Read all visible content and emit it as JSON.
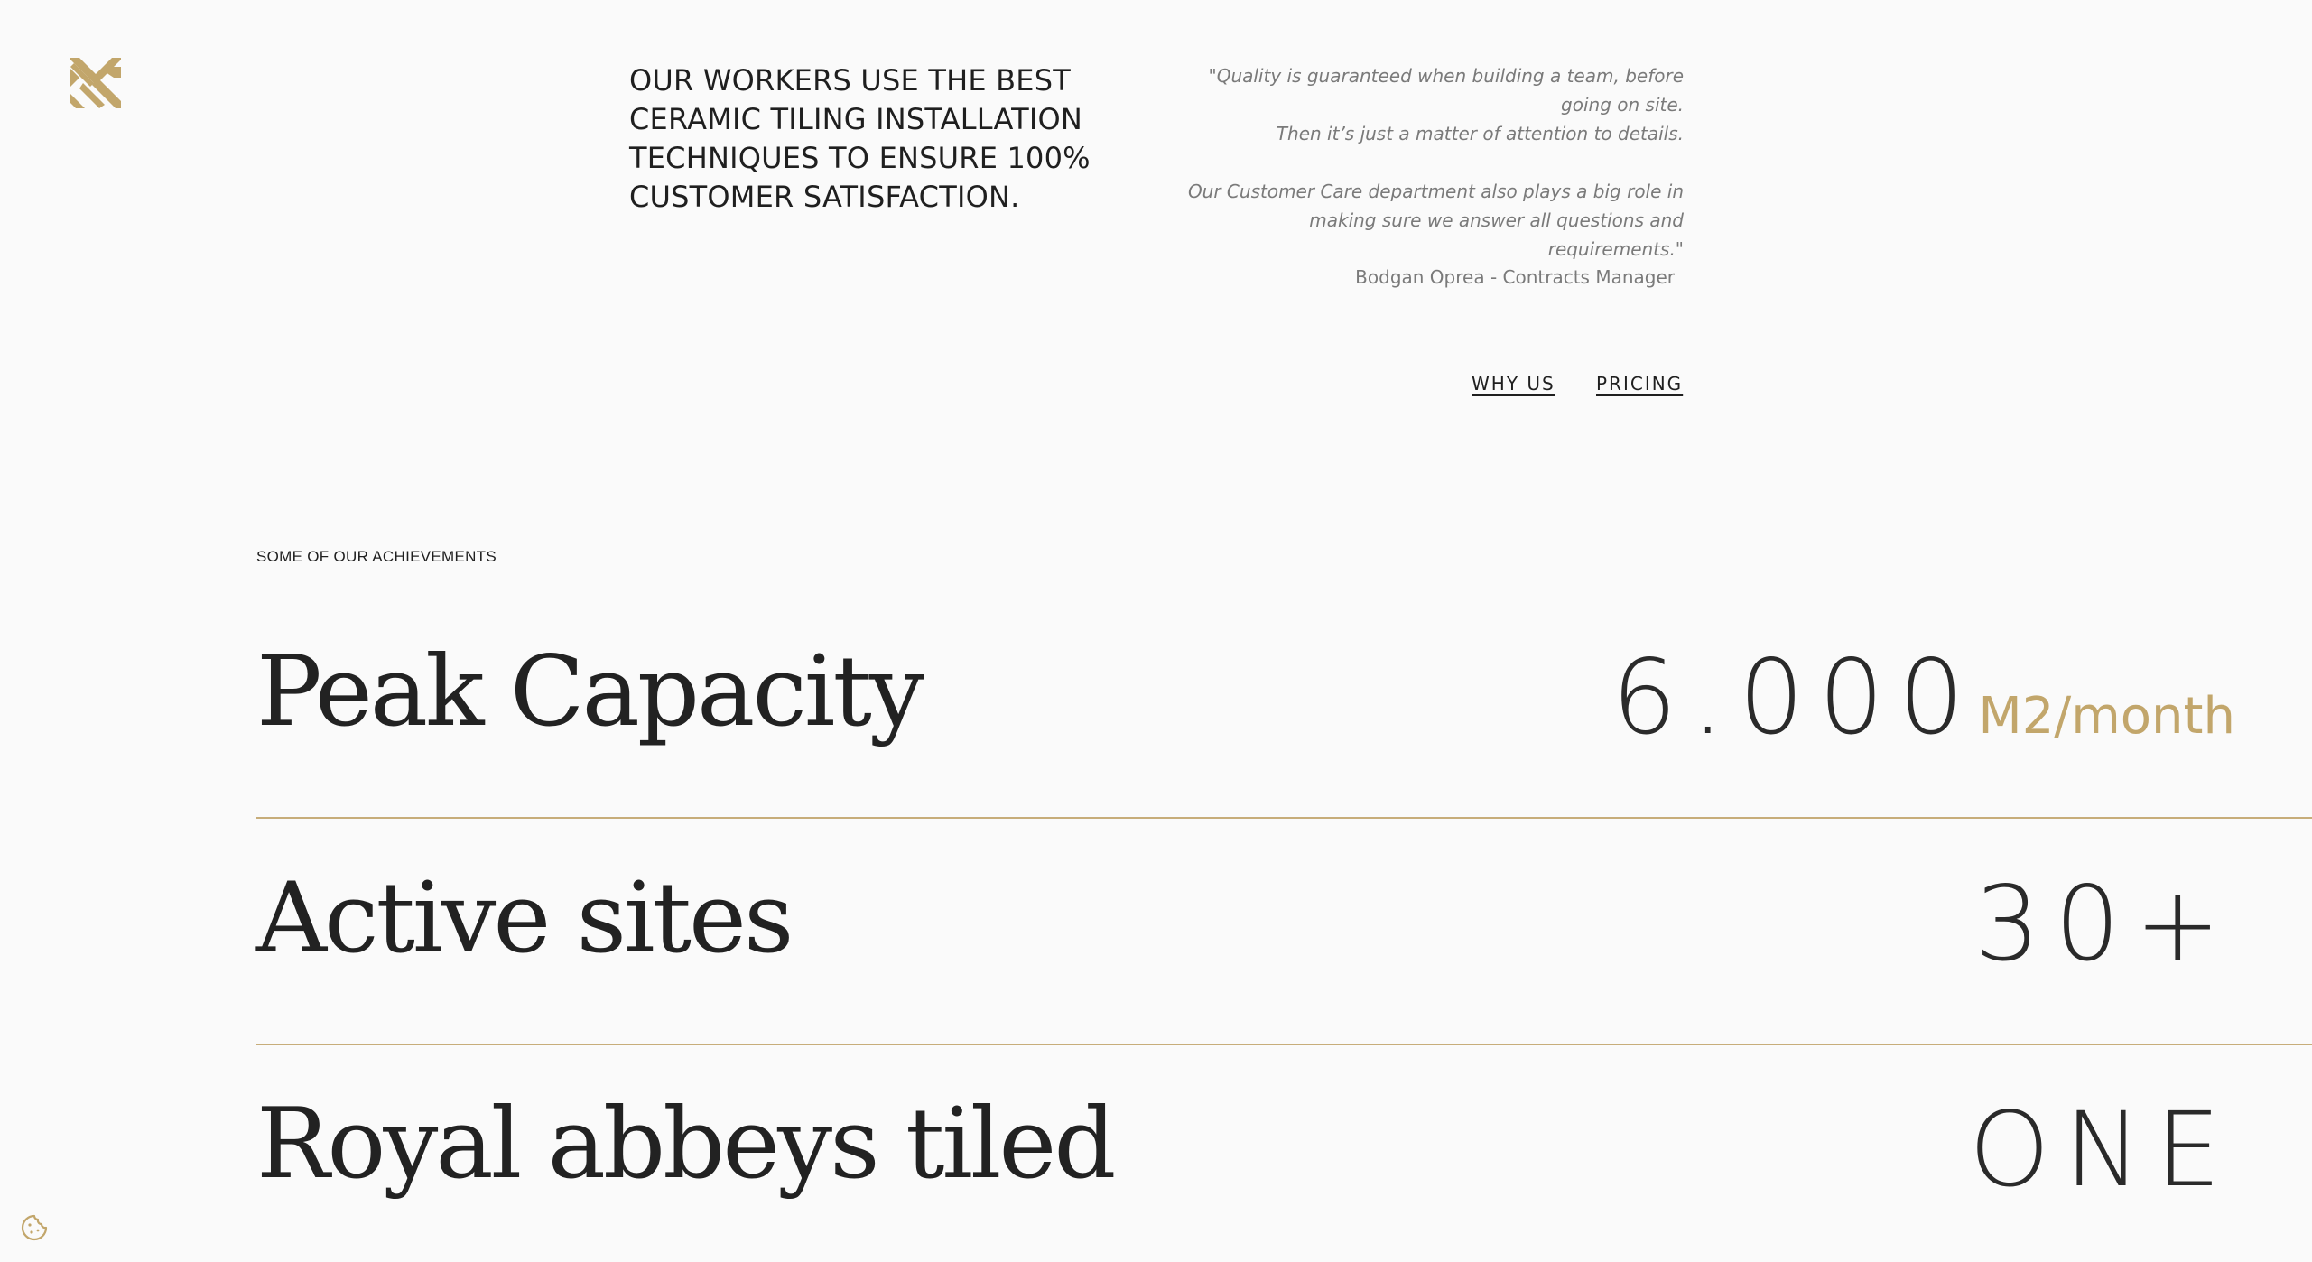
{
  "brand": {
    "accent": "#c2a66b",
    "logo_icon": "brand-chevrons-icon"
  },
  "header": {
    "headline": "OUR WORKERS USE THE BEST CERAMIC TILING INSTALLATION TECHNIQUES TO ENSURE 100% CUSTOMER SATISFACTION.",
    "quote_p1_line1": "\"Quality is guaranteed when building a team, before",
    "quote_p1_line2": "going on site.",
    "quote_p1_line3": "Then it’s just a matter of attention to details.",
    "quote_p2_line1": "Our Customer Care department also plays a big role in",
    "quote_p2_line2": "making sure we answer all questions and",
    "quote_p2_line3": "requirements.\"",
    "author": "Bodgan Oprea - Contracts Manager"
  },
  "nav": {
    "why_us": "WHY US",
    "pricing": "PRICING"
  },
  "achievements": {
    "section_label": "SOME OF OUR ACHIEVEMENTS",
    "rows": [
      {
        "label": "Peak Capacity",
        "value": "6.000",
        "unit": "M2/month"
      },
      {
        "label": "Active sites",
        "value": "30+"
      },
      {
        "label": "Royal abbeys tiled",
        "value": "ONE"
      }
    ]
  },
  "footer": {
    "cookie_icon": "cookie-icon"
  }
}
